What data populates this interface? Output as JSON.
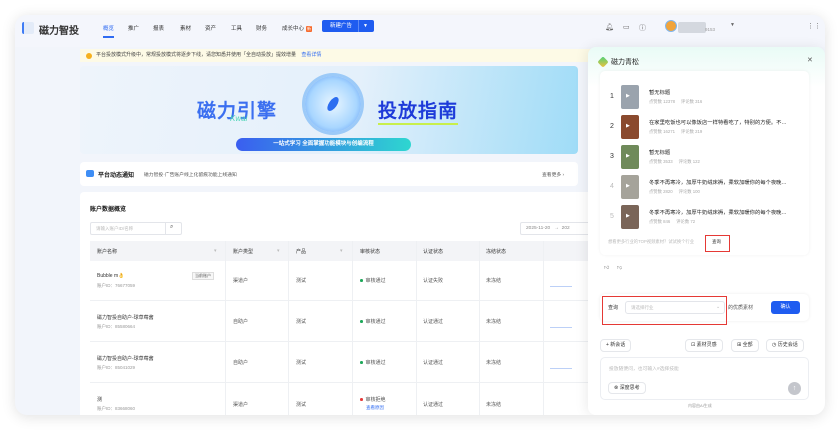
{
  "nav": {
    "logo": "磁力智投",
    "tabs": [
      "概览",
      "推广",
      "报表",
      "素材",
      "资产",
      "工具",
      "财务",
      "成长中心"
    ],
    "new_badge": "新",
    "user_id_suffix": "9153",
    "new_ad_button": "新建广告"
  },
  "notice": {
    "text": "平台投放模式升级中，常规投放模式将逐步下线，请您知悉并使用「全自动投放」提效增量",
    "link": "查看详情"
  },
  "banner": {
    "left_title": "磁力引擎",
    "right_title": "投放指南",
    "script_word": "Kwai",
    "subtitle": "一站式学习  全面掌握功能模块与创编流程"
  },
  "platform_notice": {
    "title": "平台动态通知",
    "text": "磁力智投·广告账户线上化留痕功能上线通知",
    "more": "查看更多 ›"
  },
  "accounts": {
    "title": "账户数据概览",
    "search_placeholder": "请输入账户ID/名称",
    "date_start": "2025-11-20",
    "date_sep": "→",
    "date_end": "202",
    "columns": [
      "账户名称",
      "账户类型",
      "产品",
      "审核状态",
      "认证状态",
      "冻结状态"
    ],
    "current_tag": "当前账户",
    "rows": [
      {
        "name": "Bubble m👌",
        "id": "账户ID：76677059",
        "type": "渠道户",
        "product": "测试",
        "audit": "审核通过",
        "cert": "认证失败",
        "freeze": "未冻结"
      },
      {
        "name": "磁力智投自助户-球草莓酱",
        "id": "账户ID：85580664",
        "type": "自助户",
        "product": "测试",
        "audit": "审核通过",
        "cert": "认证通过",
        "freeze": "未冻结"
      },
      {
        "name": "磁力智投自助户-球草莓酱",
        "id": "账户ID：85041029",
        "type": "自助户",
        "product": "测试",
        "audit": "审核通过",
        "cert": "认证通过",
        "freeze": "未冻结"
      },
      {
        "name": "测",
        "id": "账户ID：83668060",
        "type": "渠道户",
        "product": "测试",
        "audit": "审核拒绝",
        "audit_link": "查看原因",
        "cert": "认证通过",
        "freeze": "未冻结"
      }
    ]
  },
  "panel": {
    "title": "磁力青松",
    "items": [
      {
        "rank": "1",
        "title": "暂无标题",
        "likes": "点赞数 12378",
        "comments": "评论数 316",
        "color": "#9aa3ad"
      },
      {
        "rank": "2",
        "title": "在家里吃饭也可以像饭店一样特看吃了，特别的方便。不…",
        "likes": "点赞数 16271",
        "comments": "评论数 219",
        "color": "#8a4a2e"
      },
      {
        "rank": "3",
        "title": "暂无标题",
        "likes": "点赞数 3533",
        "comments": "评论数 122",
        "color": "#6f8a5a"
      },
      {
        "rank": "4",
        "title": "冬季不再寒冷，加厚牛奶绒床褥，柔软加暖你的每个夜晚…",
        "likes": "点赞数 2820",
        "comments": "评论数 100",
        "color": "#a5a39a"
      },
      {
        "rank": "5",
        "title": "冬季不再寒冷，加厚牛奶绒床褥，柔软加暖你的每个夜晚…",
        "likes": "点赞数 846",
        "comments": "评论数 72",
        "color": "#7a6558"
      }
    ],
    "more_hint": "想看更多行业的TOP视频素材？试试换个行业",
    "query_link": "查询",
    "query_label": "查询",
    "industry_placeholder": "请选择行业",
    "query_suffix": "的优质素材",
    "confirm": "确认",
    "new_chat": "+ 新会话",
    "chips": [
      "素材灵感",
      "全部",
      "历史会话"
    ],
    "input_placeholder": "投放随便问，也可输入#选择技能",
    "deep_think": "深度思考",
    "footer": "内容由AI生成"
  }
}
